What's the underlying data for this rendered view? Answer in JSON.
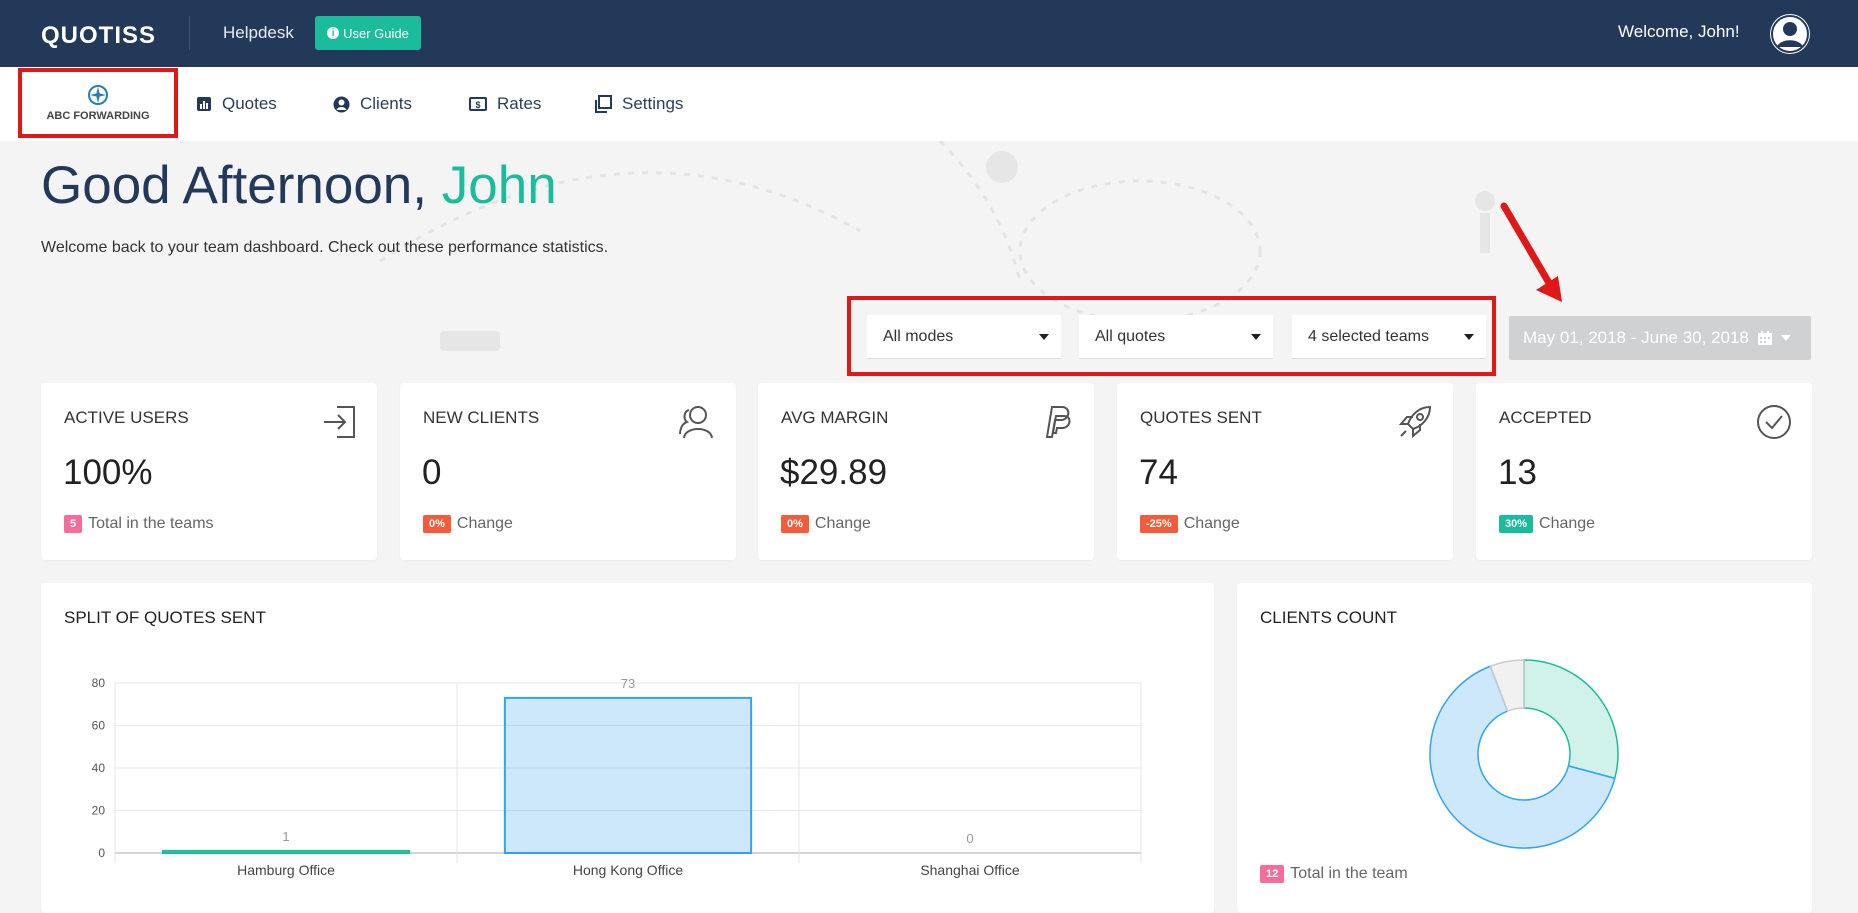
{
  "header": {
    "logo": "QUOTISS",
    "helpdesk": "Helpdesk",
    "user_guide": "User Guide",
    "welcome": "Welcome, John!"
  },
  "nav": {
    "company": "ABC FORWARDING",
    "items": [
      {
        "label": "Quotes",
        "icon": "bar-chart-icon"
      },
      {
        "label": "Clients",
        "icon": "user-circle-icon"
      },
      {
        "label": "Rates",
        "icon": "dollar-icon"
      },
      {
        "label": "Settings",
        "icon": "copy-icon"
      }
    ]
  },
  "greeting": {
    "prefix": "Good Afternoon, ",
    "name": "John",
    "subtitle": "Welcome back to your team dashboard. Check out these performance statistics."
  },
  "filters": {
    "mode": "All modes",
    "quotes": "All quotes",
    "teams": "4 selected teams",
    "date_range": "May 01, 2018 - June 30, 2018"
  },
  "stats": [
    {
      "title": "ACTIVE USERS",
      "value": "100%",
      "badge": "5",
      "badge_color": "#f66d9b",
      "foot": "Total in the teams",
      "icon": "sign-in-icon"
    },
    {
      "title": "NEW CLIENTS",
      "value": "0",
      "badge": "0%",
      "badge_color": "#f25c3c",
      "foot": "Change",
      "icon": "users-icon"
    },
    {
      "title": "AVG MARGIN",
      "value": "$29.89",
      "badge": "0%",
      "badge_color": "#f25c3c",
      "foot": "Change",
      "icon": "paypal-icon"
    },
    {
      "title": "QUOTES SENT",
      "value": "74",
      "badge": "-25%",
      "badge_color": "#f25c3c",
      "foot": "Change",
      "icon": "rocket-icon"
    },
    {
      "title": "ACCEPTED",
      "value": "13",
      "badge": "30%",
      "badge_color": "#1abc9c",
      "foot": "Change",
      "icon": "check-circle-icon"
    }
  ],
  "split_panel": {
    "title": "SPLIT OF QUOTES SENT"
  },
  "clients_panel": {
    "title": "CLIENTS COUNT",
    "badge": "12",
    "foot": "Total in the team"
  },
  "chart_data": [
    {
      "type": "bar",
      "categories": [
        "Hamburg Office",
        "Hong Kong Office",
        "Shanghai Office"
      ],
      "values": [
        1,
        73,
        0
      ],
      "yticks": [
        "0",
        "20",
        "40",
        "60",
        "80"
      ],
      "ylim": [
        0,
        80
      ],
      "grid": true,
      "colors": [
        "#1abc9c",
        "#36a2eb",
        "#999999"
      ]
    },
    {
      "type": "pie",
      "values": [
        3.5,
        7.8,
        0.7
      ],
      "colors": [
        "#1abc9c",
        "#36a2eb",
        "#cccccc"
      ]
    }
  ],
  "colors": {
    "header": "#22395a",
    "accent": "#1abc9c",
    "highlight": "#e01818"
  }
}
